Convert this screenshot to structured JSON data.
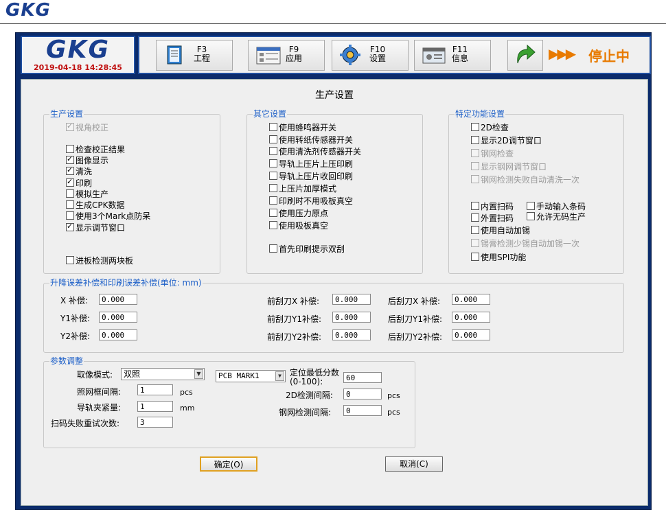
{
  "brand": "GKG",
  "header": {
    "logo": "GKG",
    "datetime": "2019-04-18 14:28:45",
    "buttons": [
      {
        "key": "F3",
        "label": "工程"
      },
      {
        "key": "F9",
        "label": "应用"
      },
      {
        "key": "F10",
        "label": "设置"
      },
      {
        "key": "F11",
        "label": "信息"
      }
    ],
    "status": "停止中",
    "status_arrows": "▶▶▶"
  },
  "page_title": "生产设置",
  "production": {
    "title": "生产设置",
    "items": [
      {
        "label": "视角校正",
        "checked": true,
        "disabled": true
      },
      {
        "label": "检查校正结果",
        "checked": false,
        "disabled": false
      },
      {
        "label": "图像显示",
        "checked": true,
        "disabled": false
      },
      {
        "label": "清洗",
        "checked": true,
        "disabled": false
      },
      {
        "label": "印刷",
        "checked": true,
        "disabled": false
      },
      {
        "label": "模拟生产",
        "checked": false,
        "disabled": false
      },
      {
        "label": "生成CPK数据",
        "checked": false,
        "disabled": false
      },
      {
        "label": "使用3个Mark点防呆",
        "checked": false,
        "disabled": false
      },
      {
        "label": "显示调节窗口",
        "checked": true,
        "disabled": false
      },
      {
        "label": "进板检测两块板",
        "checked": false,
        "disabled": false
      }
    ]
  },
  "other": {
    "title": "其它设置",
    "items": [
      {
        "label": "使用蜂鸣器开关",
        "checked": false
      },
      {
        "label": "使用转纸传感器开关",
        "checked": false
      },
      {
        "label": "使用清洗剂传感器开关",
        "checked": false
      },
      {
        "label": "导轨上压片上压印刷",
        "checked": false
      },
      {
        "label": "导轨上压片收回印刷",
        "checked": false
      },
      {
        "label": "上压片加厚模式",
        "checked": false
      },
      {
        "label": "印刷时不用吸板真空",
        "checked": false
      },
      {
        "label": "使用压力原点",
        "checked": false
      },
      {
        "label": "使用吸板真空",
        "checked": false
      },
      {
        "label": "首先印刷提示双刮",
        "checked": false
      }
    ]
  },
  "special": {
    "title": "特定功能设置",
    "items": [
      {
        "label": "2D检查",
        "checked": false,
        "disabled": false
      },
      {
        "label": "显示2D调节窗口",
        "checked": false,
        "disabled": false
      },
      {
        "label": "钢网检查",
        "checked": false,
        "disabled": true
      },
      {
        "label": "显示钢网调节窗口",
        "checked": false,
        "disabled": true
      },
      {
        "label": "钢网检测失败自动清洗一次",
        "checked": false,
        "disabled": true
      },
      {
        "label": "内置扫码",
        "checked": false,
        "disabled": false
      },
      {
        "label": "手动输入条码",
        "checked": false,
        "disabled": false
      },
      {
        "label": "外置扫码",
        "checked": false,
        "disabled": false
      },
      {
        "label": "允许无码生产",
        "checked": false,
        "disabled": false
      },
      {
        "label": "使用自动加锡",
        "checked": false,
        "disabled": false
      },
      {
        "label": "锡膏检测少锡自动加锡一次",
        "checked": false,
        "disabled": true
      },
      {
        "label": "使用SPI功能",
        "checked": false,
        "disabled": false
      }
    ]
  },
  "compensation": {
    "title": "升降误差补偿和印刷误差补偿(单位: mm)",
    "fields": [
      {
        "label": "X 补偿:",
        "value": "0.000"
      },
      {
        "label": "Y1补偿:",
        "value": "0.000"
      },
      {
        "label": "Y2补偿:",
        "value": "0.000"
      },
      {
        "label": "前刮刀X 补偿:",
        "value": "0.000"
      },
      {
        "label": "前刮刀Y1补偿:",
        "value": "0.000"
      },
      {
        "label": "前刮刀Y2补偿:",
        "value": "0.000"
      },
      {
        "label": "后刮刀X 补偿:",
        "value": "0.000"
      },
      {
        "label": "后刮刀Y1补偿:",
        "value": "0.000"
      },
      {
        "label": "后刮刀Y2补偿:",
        "value": "0.000"
      }
    ]
  },
  "params": {
    "title": "参数调整",
    "capture_mode_label": "取像模式:",
    "capture_mode_value": "双照",
    "mark_select_value": "PCB MARK1",
    "min_score_label": "定位最低分数(0-100):",
    "min_score_value": "60",
    "frame_interval_label": "照网框间隔:",
    "frame_interval_value": "1",
    "frame_interval_unit": "pcs",
    "clamp_label": "导轨夹紧量:",
    "clamp_value": "1",
    "clamp_unit": "mm",
    "retry_label": "扫码失败重试次数:",
    "retry_value": "3",
    "d2_interval_label": "2D检测间隔:",
    "d2_interval_value": "0",
    "d2_interval_unit": "pcs",
    "stencil_interval_label": "钢网检测间隔:",
    "stencil_interval_value": "0",
    "stencil_interval_unit": "pcs"
  },
  "actions": {
    "ok": "确定(O)",
    "cancel": "取消(C)"
  }
}
